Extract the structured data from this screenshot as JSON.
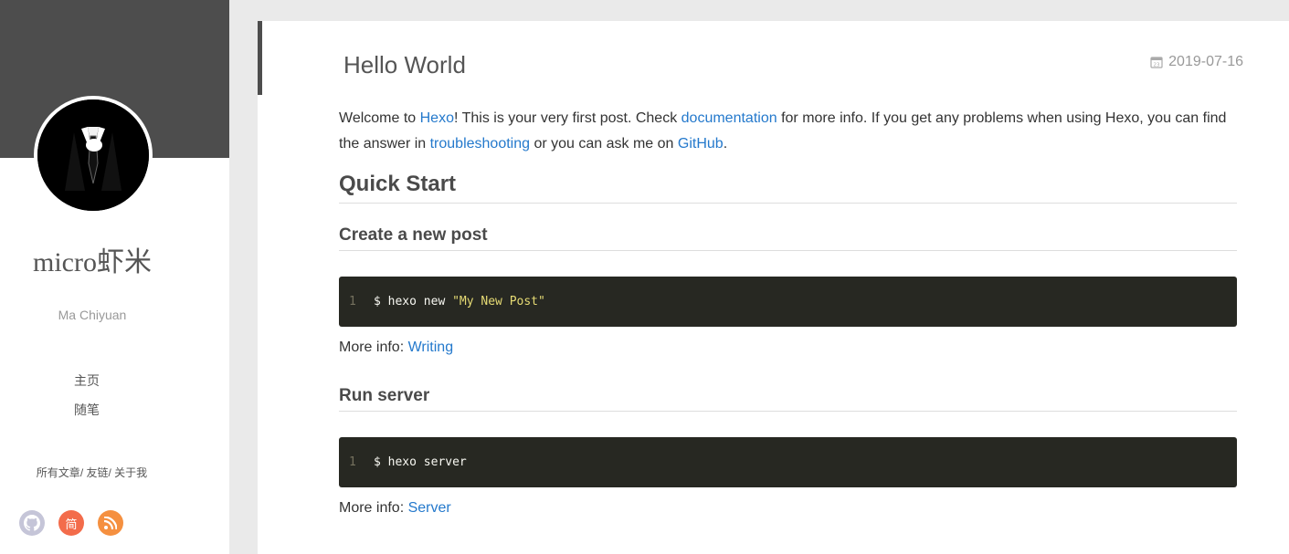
{
  "sidebar": {
    "site_name": "micro虾米",
    "author": "Ma Chiyuan",
    "nav": [
      {
        "label": "主页"
      },
      {
        "label": "随笔"
      }
    ],
    "links": [
      "所有文章",
      "友链",
      "关于我"
    ],
    "social": [
      {
        "name": "github-icon",
        "glyph": "",
        "color": "#c5c5d8"
      },
      {
        "name": "jianshu-icon",
        "glyph": "简",
        "color": "#f36c4b"
      },
      {
        "name": "rss-icon",
        "glyph": "",
        "color": "#f59040"
      }
    ]
  },
  "post": {
    "title": "Hello World",
    "date": "2019-07-16",
    "intro": {
      "t1": "Welcome to ",
      "hexo": "Hexo",
      "t2": "! This is your very first post. Check ",
      "documentation": "documentation",
      "t3": " for more info. If you get any problems when using Hexo, you can find the answer in ",
      "troubleshooting": "troubleshooting",
      "t4": " or you can ask me on ",
      "github": "GitHub",
      "t5": "."
    },
    "quick_start": "Quick Start",
    "create_post": {
      "heading": "Create a new post",
      "line_no": "1",
      "cmd": "$ hexo new ",
      "arg": "\"My New Post\"",
      "info_label": "More info: ",
      "info_link": "Writing"
    },
    "run_server": {
      "heading": "Run server",
      "line_no": "1",
      "cmd": "$ hexo server",
      "info_label": "More info: ",
      "info_link": "Server"
    }
  }
}
